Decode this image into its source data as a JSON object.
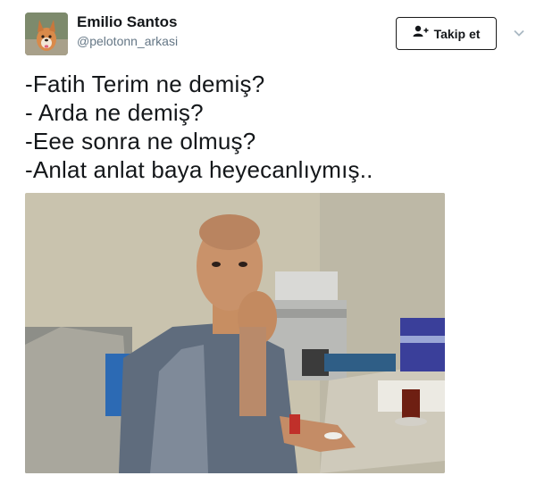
{
  "header": {
    "name": "Emilio Santos",
    "handle": "@pelotonn_arkasi",
    "follow_label": "Takip et"
  },
  "tweet": {
    "lines": [
      "-Fatih Terim ne demiş?",
      "- Arda ne demiş?",
      "-Eee sonra ne olmuş?",
      "-Anlat anlat baya heyecanlıymış.."
    ]
  },
  "icons": {
    "follow": "add-user-icon",
    "menu": "chevron-down-icon"
  }
}
